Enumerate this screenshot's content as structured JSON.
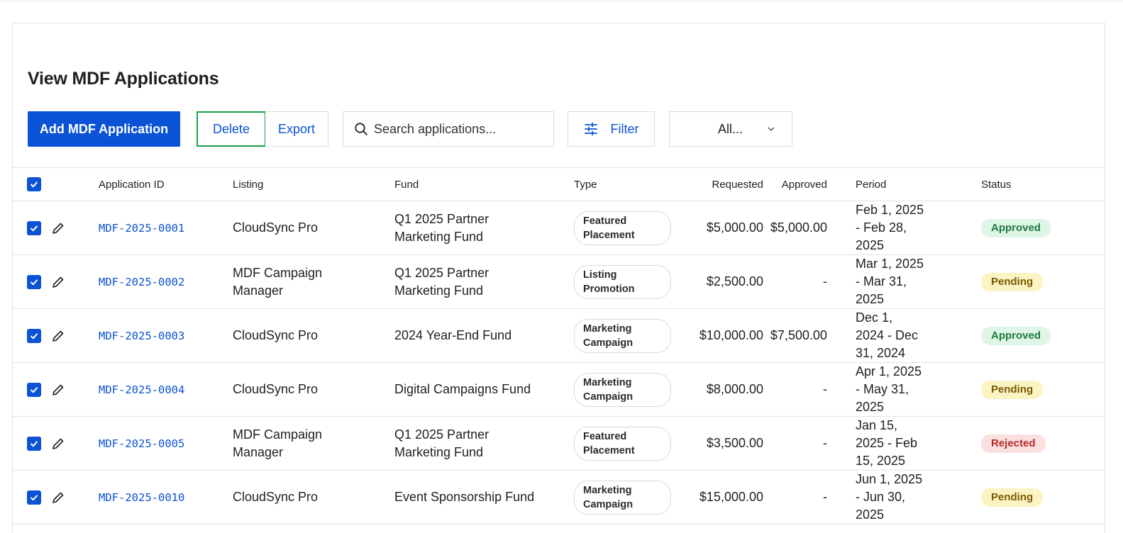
{
  "page_title": "View MDF Applications",
  "toolbar": {
    "add_label": "Add MDF Application",
    "delete_label": "Delete",
    "export_label": "Export",
    "search_placeholder": "Search applications...",
    "filter_label": "Filter",
    "select_value": "All..."
  },
  "colors": {
    "primary": "#0a52d6",
    "highlight_border": "#17a346",
    "approved": "#1e7a3e",
    "pending": "#7a5a05",
    "rejected": "#b22a2a"
  },
  "table": {
    "headers": {
      "app_id": "Application ID",
      "listing": "Listing",
      "fund": "Fund",
      "type": "Type",
      "requested": "Requested",
      "approved": "Approved",
      "period": "Period",
      "status": "Status"
    },
    "rows": [
      {
        "id": "MDF-2025-0001",
        "listing": "CloudSync Pro",
        "fund": "Q1 2025 Partner Marketing Fund",
        "type": "Featured Placement",
        "requested": "$5,000.00",
        "approved": "$5,000.00",
        "period": "Feb 1, 2025 - Feb 28, 2025",
        "status": "Approved"
      },
      {
        "id": "MDF-2025-0002",
        "listing": "MDF Campaign Manager",
        "fund": "Q1 2025 Partner Marketing Fund",
        "type": "Listing Promotion",
        "requested": "$2,500.00",
        "approved": "-",
        "period": "Mar 1, 2025 - Mar 31, 2025",
        "status": "Pending"
      },
      {
        "id": "MDF-2025-0003",
        "listing": "CloudSync Pro",
        "fund": "2024 Year-End Fund",
        "type": "Marketing Campaign",
        "requested": "$10,000.00",
        "approved": "$7,500.00",
        "period": "Dec 1, 2024 - Dec 31, 2024",
        "status": "Approved"
      },
      {
        "id": "MDF-2025-0004",
        "listing": "CloudSync Pro",
        "fund": "Digital Campaigns Fund",
        "type": "Marketing Campaign",
        "requested": "$8,000.00",
        "approved": "-",
        "period": "Apr 1, 2025 - May 31, 2025",
        "status": "Pending"
      },
      {
        "id": "MDF-2025-0005",
        "listing": "MDF Campaign Manager",
        "fund": "Q1 2025 Partner Marketing Fund",
        "type": "Featured Placement",
        "requested": "$3,500.00",
        "approved": "-",
        "period": "Jan 15, 2025 - Feb 15, 2025",
        "status": "Rejected"
      },
      {
        "id": "MDF-2025-0010",
        "listing": "CloudSync Pro",
        "fund": "Event Sponsorship Fund",
        "type": "Marketing Campaign",
        "requested": "$15,000.00",
        "approved": "-",
        "period": "Jun 1, 2025 - Jun 30, 2025",
        "status": "Pending"
      }
    ]
  }
}
